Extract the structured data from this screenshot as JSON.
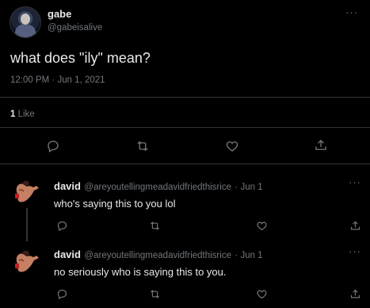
{
  "tweet": {
    "author_name": "gabe",
    "author_handle": "@gabeisalive",
    "text": "what does \"ily\" mean?",
    "timestamp": "12:00 PM · Jun 1, 2021",
    "like_count": "1",
    "like_label": "Like"
  },
  "replies": [
    {
      "author_name": "david",
      "author_handle": "@areyoutellingmeadavidfriedthisrice",
      "date": "· Jun 1",
      "text": "who's saying this to you lol"
    },
    {
      "author_name": "david",
      "author_handle": "@areyoutellingmeadavidfriedthisrice",
      "date": "· Jun 1",
      "text": "no seriously who is saying this to you."
    }
  ],
  "more_label": "···",
  "icons": [
    "reply-icon",
    "retweet-icon",
    "like-icon",
    "share-icon",
    "more-icon"
  ],
  "colors": {
    "background": "#000000",
    "text": "#e7e9ea",
    "muted": "#71767b",
    "divider": "#2f3336"
  }
}
